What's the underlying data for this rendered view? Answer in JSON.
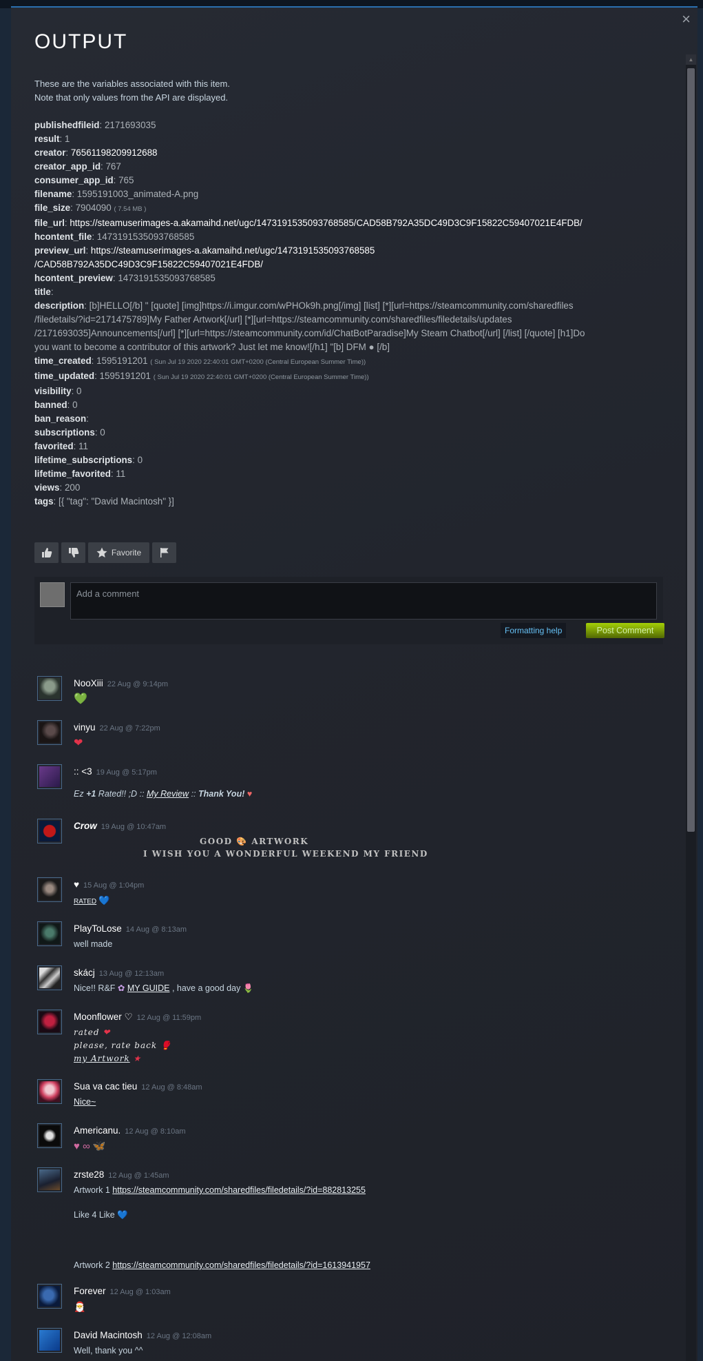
{
  "modal": {
    "title": "OUTPUT",
    "close_glyph": "×",
    "intro_line1": "These are the variables associated with this item.",
    "intro_line2": "Note that only values from the API are displayed."
  },
  "variables": {
    "publishedfileid": {
      "key": "publishedfileid",
      "value": "2171693035"
    },
    "result": {
      "key": "result",
      "value": "1"
    },
    "creator": {
      "key": "creator",
      "value": "76561198209912688"
    },
    "creator_app_id": {
      "key": "creator_app_id",
      "value": "767"
    },
    "consumer_app_id": {
      "key": "consumer_app_id",
      "value": "765"
    },
    "filename": {
      "key": "filename",
      "value": "1595191003_animated-A.png"
    },
    "file_size": {
      "key": "file_size",
      "value": "7904090",
      "note": "( 7.54 MB )"
    },
    "file_url": {
      "key": "file_url",
      "value": "https://steamuserimages-a.akamaihd.net/ugc/1473191535093768585/CAD58B792A35DC49D3C9F15822C59407021E4FDB/"
    },
    "hcontent_file": {
      "key": "hcontent_file",
      "value": "1473191535093768585"
    },
    "preview_url": {
      "key": "preview_url",
      "value_line1": "https://steamuserimages-a.akamaihd.net/ugc/1473191535093768585",
      "value_line2": "/CAD58B792A35DC49D3C9F15822C59407021E4FDB/"
    },
    "hcontent_preview": {
      "key": "hcontent_preview",
      "value": "1473191535093768585"
    },
    "title": {
      "key": "title",
      "value": ""
    },
    "description": {
      "key": "description",
      "line1": "[b]HELLO[/b] \" [quote] [img]https://i.imgur.com/wPHOk9h.png[/img] [list] [*][url=https://steamcommunity.com/sharedfiles",
      "line2": "/filedetails/?id=2171475789]My Father Artwork[/url] [*][url=https://steamcommunity.com/sharedfiles/filedetails/updates",
      "line3": "/2171693035]Announcements[/url] [*][url=https://steamcommunity.com/id/ChatBotParadise]My Steam Chatbot[/url] [/list] [/quote] [h1]Do",
      "line4": "you want to become a contributor of this artwork? Just let me know![/h1] \"[b] DFM ● [/b]"
    },
    "time_created": {
      "key": "time_created",
      "value": "1595191201",
      "note": "( Sun Jul 19 2020 22:40:01 GMT+0200 (Central European Summer Time))"
    },
    "time_updated": {
      "key": "time_updated",
      "value": "1595191201",
      "note": "( Sun Jul 19 2020 22:40:01 GMT+0200 (Central European Summer Time))"
    },
    "visibility": {
      "key": "visibility",
      "value": "0"
    },
    "banned": {
      "key": "banned",
      "value": "0"
    },
    "ban_reason": {
      "key": "ban_reason",
      "value": ""
    },
    "subscriptions": {
      "key": "subscriptions",
      "value": "0"
    },
    "favorited": {
      "key": "favorited",
      "value": "11"
    },
    "lifetime_subscriptions": {
      "key": "lifetime_subscriptions",
      "value": "0"
    },
    "lifetime_favorited": {
      "key": "lifetime_favorited",
      "value": "11"
    },
    "views": {
      "key": "views",
      "value": "200"
    },
    "tags": {
      "key": "tags",
      "value": "[{ \"tag\": \"David Macintosh\" }]"
    }
  },
  "actions": {
    "favorite_label": "Favorite",
    "icons": [
      "thumbs-up-icon",
      "thumbs-down-icon",
      "star-icon",
      "flag-icon"
    ]
  },
  "comment_form": {
    "placeholder": "Add a comment",
    "formatting_help": "Formatting help",
    "post_button": "Post Comment"
  },
  "comments": [
    {
      "name": "NooXiii",
      "time": "22 Aug @ 9:14pm",
      "body": "💚"
    },
    {
      "name": "vinyu",
      "time": "22 Aug @ 7:22pm",
      "body": "❤"
    },
    {
      "name": ":: <3",
      "time": "19 Aug @ 5:17pm",
      "body_pre": "Ez ",
      "body_bold": "+1",
      "body_mid": " Rated!! ;D :: ",
      "body_link": "My Review",
      "body_post": " :: ",
      "body_bold2": "Thank You!"
    },
    {
      "name": "Crow",
      "time": "19 Aug @ 10:47am",
      "line1": "GOOD 🎨 ARTWORK",
      "line2": "I WISH YOU A WONDERFUL WEEKEND MY FRIEND"
    },
    {
      "name": "♥",
      "time": "15 Aug @ 1:04pm",
      "body_link": "RATED",
      "body_post": "💙"
    },
    {
      "name": "PlayToLose",
      "time": "14 Aug @ 8:13am",
      "body": "well made"
    },
    {
      "name": "skácj",
      "time": "13 Aug @ 12:13am",
      "body_pre": "Nice!! R&F ",
      "body_link": "MY GUIDE",
      "body_post": " , have a good day"
    },
    {
      "name": "Moonflower ♡",
      "time": "12 Aug @ 11:59pm",
      "line1": "rated",
      "line2": "please, rate back",
      "line3": "my Artwork"
    },
    {
      "name": "Sua va cac tieu",
      "time": "12 Aug @ 8:48am",
      "body_link": "Nice~"
    },
    {
      "name": "Americanu.",
      "time": "12 Aug @ 8:10am",
      "body": "♥ ∞ 🦋"
    },
    {
      "name": "zrste28",
      "time": "12 Aug @ 1:45am",
      "line1_pre": "Artwork 1 ",
      "line1_link": "https://steamcommunity.com/sharedfiles/filedetails/?id=882813255",
      "line2": "Like 4 Like",
      "line3_pre": "Artwork 2 ",
      "line3_link": "https://steamcommunity.com/sharedfiles/filedetails/?id=1613941957"
    },
    {
      "name": "Forever",
      "time": "12 Aug @ 1:03am",
      "body": "🎅"
    },
    {
      "name": "David Macintosh",
      "time": "12 Aug @ 12:08am",
      "body": "Well, thank you ^^"
    }
  ],
  "colors": {
    "accent_blue": "#66c0f4",
    "post_green": "#a4d007",
    "background": "#22252d"
  }
}
